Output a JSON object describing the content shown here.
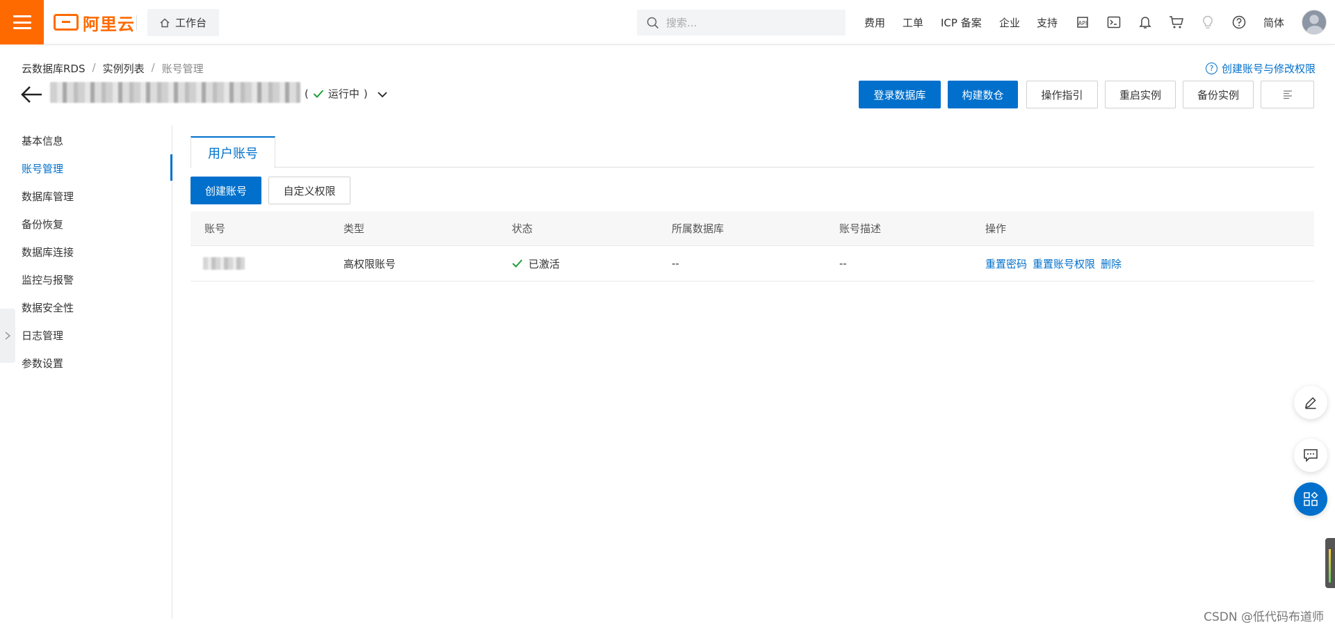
{
  "topbar": {
    "logo_text": "阿里云",
    "workbench_label": "工作台",
    "search_placeholder": "搜索...",
    "nav": [
      "费用",
      "工单",
      "ICP 备案",
      "企业",
      "支持"
    ],
    "lang_label": "简体",
    "icons": [
      "api-icon",
      "terminal-icon",
      "bell-icon",
      "cart-icon",
      "lightbulb-icon",
      "help-circle-icon"
    ]
  },
  "header": {
    "breadcrumb": [
      "云数据库RDS",
      "实例列表",
      "账号管理"
    ],
    "help_link": "创建账号与修改权限",
    "status_open": "(",
    "status_text": "运行中",
    "status_close": ")",
    "actions": [
      "登录数据库",
      "构建数仓",
      "操作指引",
      "重启实例",
      "备份实例"
    ]
  },
  "sidebar": {
    "items": [
      "基本信息",
      "账号管理",
      "数据库管理",
      "备份恢复",
      "数据库连接",
      "监控与报警",
      "数据安全性",
      "日志管理",
      "参数设置"
    ],
    "active_index": 1
  },
  "main": {
    "tab_label": "用户账号",
    "create_button": "创建账号",
    "custom_button": "自定义权限",
    "table": {
      "columns": [
        "账号",
        "类型",
        "状态",
        "所属数据库",
        "账号描述",
        "操作"
      ],
      "rows": [
        {
          "type": "高权限账号",
          "status": "已激活",
          "database": "--",
          "description": "--",
          "operations": [
            "重置密码",
            "重置账号权限",
            "删除"
          ]
        }
      ]
    }
  },
  "watermark": "CSDN @低代码布道师",
  "colors": {
    "brand_orange": "#ff6a00",
    "primary_blue": "#0070cc",
    "success_green": "#1f9e3b"
  }
}
